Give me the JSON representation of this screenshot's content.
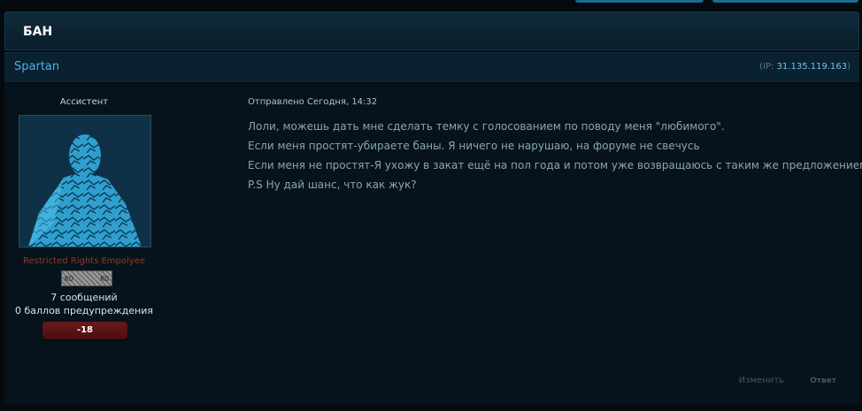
{
  "topic": {
    "title": "БАН"
  },
  "post": {
    "author": "Spartan",
    "ip_prefix": "IP: ",
    "ip": "31.135.119.163",
    "date": "Отправлено Сегодня, 14:32",
    "lines": [
      "Лоли, можешь дать мне сделать темку с голосованием по поводу меня \"любимого\".",
      "Если меня простят-убираете баны. Я ничего не нарушаю, на форуме не свечусь",
      "Если меня не простят-Я ухожу в закат ещё на пол года и потом уже возвращаюсь с таким же предложением",
      "P.S Ну дай шанс, что как жук?"
    ],
    "actions": {
      "edit": "Изменить",
      "reply": "Ответ"
    }
  },
  "author_panel": {
    "role": "Ассистент",
    "rank_title": "Restricted Rights Empolyee",
    "rank_image_text": [
      "КО",
      "КО"
    ],
    "post_count": "7 сообщений",
    "warn_points": "0 баллов предупреждения",
    "reputation": "-18"
  }
}
